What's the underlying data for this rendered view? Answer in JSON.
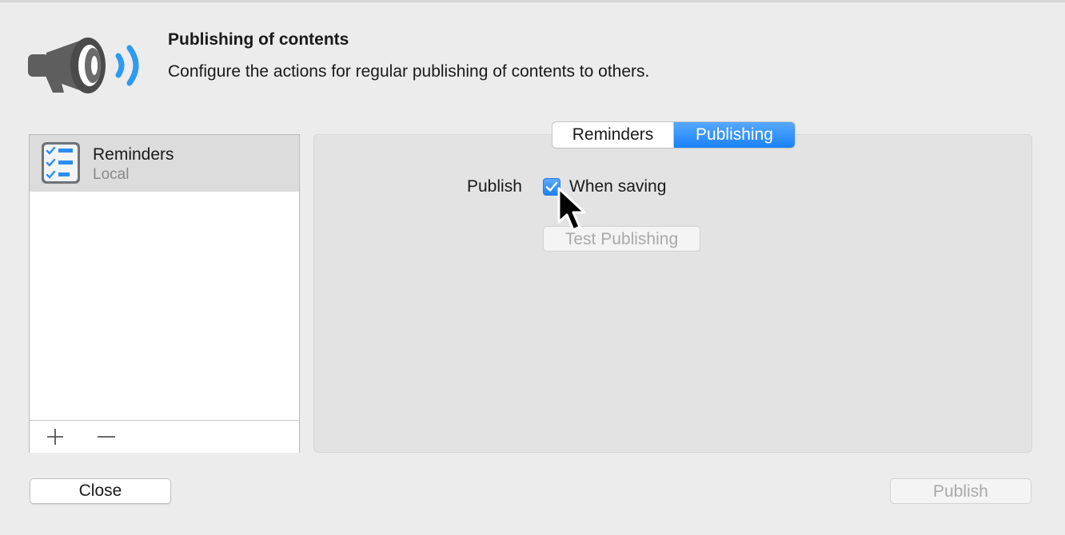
{
  "header": {
    "title": "Publishing of contents",
    "description": "Configure the actions for regular publishing of contents to others.",
    "icon": "megaphone-icon"
  },
  "source_list": {
    "items": [
      {
        "title": "Reminders",
        "subtitle": "Local",
        "icon": "reminders-list-icon",
        "selected": true
      }
    ],
    "add_icon": "plus-icon",
    "remove_icon": "minus-icon"
  },
  "tabs": [
    {
      "label": "Reminders",
      "selected": false
    },
    {
      "label": "Publishing",
      "selected": true
    }
  ],
  "publishing": {
    "publish_label": "Publish",
    "when_saving_label": "When saving",
    "when_saving_checked": true,
    "test_button_label": "Test Publishing"
  },
  "footer": {
    "close_label": "Close",
    "publish_label": "Publish"
  },
  "colors": {
    "accent": "#1a82fb",
    "window_bg": "#ececec"
  }
}
